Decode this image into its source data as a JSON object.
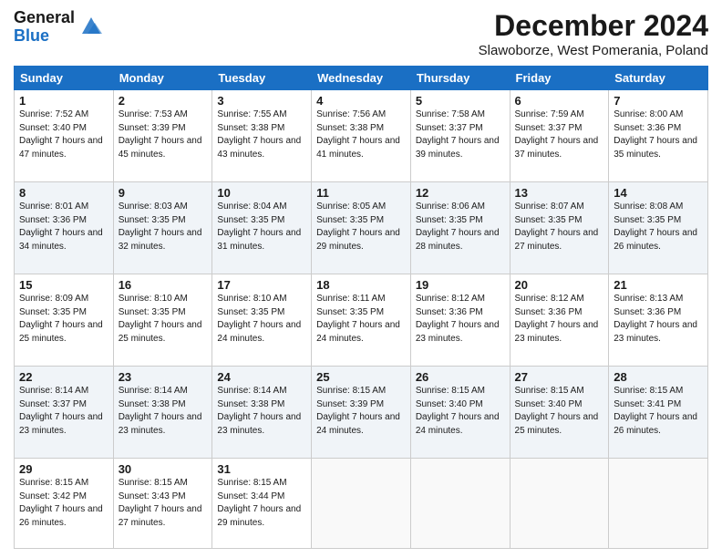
{
  "header": {
    "logo_line1": "General",
    "logo_line2": "Blue",
    "main_title": "December 2024",
    "subtitle": "Slawoborze, West Pomerania, Poland"
  },
  "days_of_week": [
    "Sunday",
    "Monday",
    "Tuesday",
    "Wednesday",
    "Thursday",
    "Friday",
    "Saturday"
  ],
  "weeks": [
    [
      {
        "day": "1",
        "sunrise": "Sunrise: 7:52 AM",
        "sunset": "Sunset: 3:40 PM",
        "daylight": "Daylight: 7 hours and 47 minutes."
      },
      {
        "day": "2",
        "sunrise": "Sunrise: 7:53 AM",
        "sunset": "Sunset: 3:39 PM",
        "daylight": "Daylight: 7 hours and 45 minutes."
      },
      {
        "day": "3",
        "sunrise": "Sunrise: 7:55 AM",
        "sunset": "Sunset: 3:38 PM",
        "daylight": "Daylight: 7 hours and 43 minutes."
      },
      {
        "day": "4",
        "sunrise": "Sunrise: 7:56 AM",
        "sunset": "Sunset: 3:38 PM",
        "daylight": "Daylight: 7 hours and 41 minutes."
      },
      {
        "day": "5",
        "sunrise": "Sunrise: 7:58 AM",
        "sunset": "Sunset: 3:37 PM",
        "daylight": "Daylight: 7 hours and 39 minutes."
      },
      {
        "day": "6",
        "sunrise": "Sunrise: 7:59 AM",
        "sunset": "Sunset: 3:37 PM",
        "daylight": "Daylight: 7 hours and 37 minutes."
      },
      {
        "day": "7",
        "sunrise": "Sunrise: 8:00 AM",
        "sunset": "Sunset: 3:36 PM",
        "daylight": "Daylight: 7 hours and 35 minutes."
      }
    ],
    [
      {
        "day": "8",
        "sunrise": "Sunrise: 8:01 AM",
        "sunset": "Sunset: 3:36 PM",
        "daylight": "Daylight: 7 hours and 34 minutes."
      },
      {
        "day": "9",
        "sunrise": "Sunrise: 8:03 AM",
        "sunset": "Sunset: 3:35 PM",
        "daylight": "Daylight: 7 hours and 32 minutes."
      },
      {
        "day": "10",
        "sunrise": "Sunrise: 8:04 AM",
        "sunset": "Sunset: 3:35 PM",
        "daylight": "Daylight: 7 hours and 31 minutes."
      },
      {
        "day": "11",
        "sunrise": "Sunrise: 8:05 AM",
        "sunset": "Sunset: 3:35 PM",
        "daylight": "Daylight: 7 hours and 29 minutes."
      },
      {
        "day": "12",
        "sunrise": "Sunrise: 8:06 AM",
        "sunset": "Sunset: 3:35 PM",
        "daylight": "Daylight: 7 hours and 28 minutes."
      },
      {
        "day": "13",
        "sunrise": "Sunrise: 8:07 AM",
        "sunset": "Sunset: 3:35 PM",
        "daylight": "Daylight: 7 hours and 27 minutes."
      },
      {
        "day": "14",
        "sunrise": "Sunrise: 8:08 AM",
        "sunset": "Sunset: 3:35 PM",
        "daylight": "Daylight: 7 hours and 26 minutes."
      }
    ],
    [
      {
        "day": "15",
        "sunrise": "Sunrise: 8:09 AM",
        "sunset": "Sunset: 3:35 PM",
        "daylight": "Daylight: 7 hours and 25 minutes."
      },
      {
        "day": "16",
        "sunrise": "Sunrise: 8:10 AM",
        "sunset": "Sunset: 3:35 PM",
        "daylight": "Daylight: 7 hours and 25 minutes."
      },
      {
        "day": "17",
        "sunrise": "Sunrise: 8:10 AM",
        "sunset": "Sunset: 3:35 PM",
        "daylight": "Daylight: 7 hours and 24 minutes."
      },
      {
        "day": "18",
        "sunrise": "Sunrise: 8:11 AM",
        "sunset": "Sunset: 3:35 PM",
        "daylight": "Daylight: 7 hours and 24 minutes."
      },
      {
        "day": "19",
        "sunrise": "Sunrise: 8:12 AM",
        "sunset": "Sunset: 3:36 PM",
        "daylight": "Daylight: 7 hours and 23 minutes."
      },
      {
        "day": "20",
        "sunrise": "Sunrise: 8:12 AM",
        "sunset": "Sunset: 3:36 PM",
        "daylight": "Daylight: 7 hours and 23 minutes."
      },
      {
        "day": "21",
        "sunrise": "Sunrise: 8:13 AM",
        "sunset": "Sunset: 3:36 PM",
        "daylight": "Daylight: 7 hours and 23 minutes."
      }
    ],
    [
      {
        "day": "22",
        "sunrise": "Sunrise: 8:14 AM",
        "sunset": "Sunset: 3:37 PM",
        "daylight": "Daylight: 7 hours and 23 minutes."
      },
      {
        "day": "23",
        "sunrise": "Sunrise: 8:14 AM",
        "sunset": "Sunset: 3:38 PM",
        "daylight": "Daylight: 7 hours and 23 minutes."
      },
      {
        "day": "24",
        "sunrise": "Sunrise: 8:14 AM",
        "sunset": "Sunset: 3:38 PM",
        "daylight": "Daylight: 7 hours and 23 minutes."
      },
      {
        "day": "25",
        "sunrise": "Sunrise: 8:15 AM",
        "sunset": "Sunset: 3:39 PM",
        "daylight": "Daylight: 7 hours and 24 minutes."
      },
      {
        "day": "26",
        "sunrise": "Sunrise: 8:15 AM",
        "sunset": "Sunset: 3:40 PM",
        "daylight": "Daylight: 7 hours and 24 minutes."
      },
      {
        "day": "27",
        "sunrise": "Sunrise: 8:15 AM",
        "sunset": "Sunset: 3:40 PM",
        "daylight": "Daylight: 7 hours and 25 minutes."
      },
      {
        "day": "28",
        "sunrise": "Sunrise: 8:15 AM",
        "sunset": "Sunset: 3:41 PM",
        "daylight": "Daylight: 7 hours and 26 minutes."
      }
    ],
    [
      {
        "day": "29",
        "sunrise": "Sunrise: 8:15 AM",
        "sunset": "Sunset: 3:42 PM",
        "daylight": "Daylight: 7 hours and 26 minutes."
      },
      {
        "day": "30",
        "sunrise": "Sunrise: 8:15 AM",
        "sunset": "Sunset: 3:43 PM",
        "daylight": "Daylight: 7 hours and 27 minutes."
      },
      {
        "day": "31",
        "sunrise": "Sunrise: 8:15 AM",
        "sunset": "Sunset: 3:44 PM",
        "daylight": "Daylight: 7 hours and 29 minutes."
      },
      null,
      null,
      null,
      null
    ]
  ]
}
